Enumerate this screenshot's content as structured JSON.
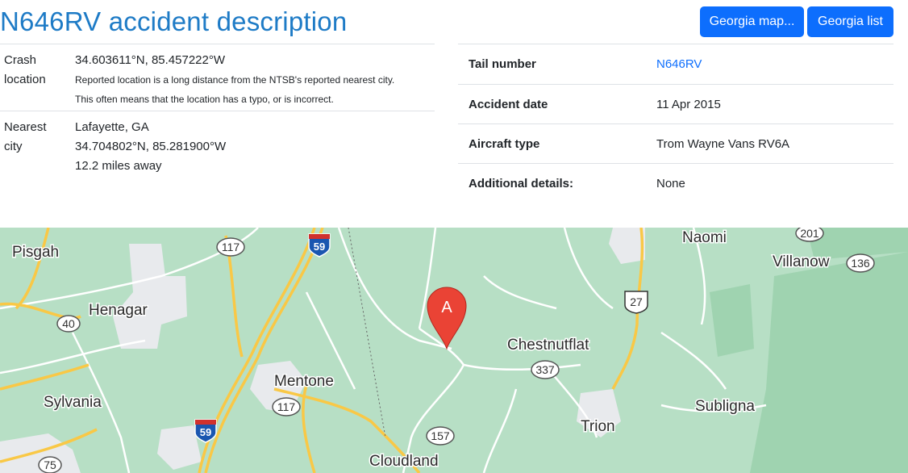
{
  "page": {
    "title": "N646RV accident description"
  },
  "buttons": {
    "map": "Georgia map...",
    "list": "Georgia list"
  },
  "crash": {
    "label_line1": "Crash",
    "label_line2": "location",
    "coords": "34.603611°N, 85.457222°W",
    "note_line1": "Reported location is a long distance from the NTSB's reported nearest city.",
    "note_line2": "This often means that the location has a typo, or is incorrect."
  },
  "nearest": {
    "label_line1": "Nearest",
    "label_line2": "city",
    "city": "Lafayette, GA",
    "coords": "34.704802°N, 85.281900°W",
    "distance": "12.2 miles away"
  },
  "details": [
    {
      "key": "Tail number",
      "value": "N646RV"
    },
    {
      "key": "Accident date",
      "value": "11 Apr 2015"
    },
    {
      "key": "Aircraft type",
      "value": "Trom Wayne Vans RV6A"
    },
    {
      "key": "Additional details:",
      "value": "None"
    }
  ],
  "map": {
    "marker_label": "A",
    "towns": [
      "Pisgah",
      "Henagar",
      "Sylvania",
      "Mentone",
      "Naomi",
      "Villanow",
      "Chestnutflat",
      "Subligna",
      "Trion",
      "Cloudland"
    ],
    "routes": [
      "117",
      "59",
      "40",
      "117",
      "59",
      "75",
      "157",
      "337",
      "27",
      "201",
      "136"
    ],
    "colors": {
      "land": "#b7dfc5",
      "road_major": "#f9c846",
      "road_minor": "#ffffff",
      "urban": "#e8eaed",
      "marker": "#ea4335"
    }
  }
}
